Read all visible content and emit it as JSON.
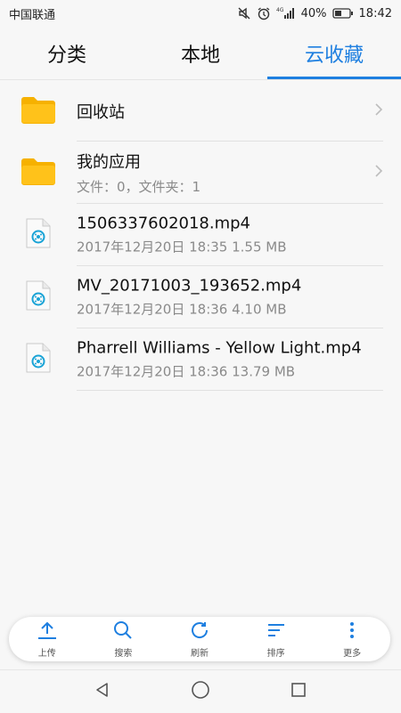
{
  "status": {
    "carrier": "中国联通",
    "network": "4G",
    "battery": "40%",
    "time": "18:42",
    "icons": [
      "mute-icon",
      "alarm-icon",
      "signal-icon",
      "battery-icon"
    ]
  },
  "tabs": [
    {
      "label": "分类",
      "active": false
    },
    {
      "label": "本地",
      "active": false
    },
    {
      "label": "云收藏",
      "active": true
    }
  ],
  "accent_color": "#1e7fe0",
  "folders": [
    {
      "name": "回收站",
      "detail": ""
    },
    {
      "name": "我的应用",
      "detail": "文件：0，文件夹：1"
    }
  ],
  "files": [
    {
      "name": "1506337602018.mp4",
      "detail": "2017年12月20日 18:35 1.55 MB"
    },
    {
      "name": "MV_20171003_193652.mp4",
      "detail": "2017年12月20日 18:36 4.10 MB"
    },
    {
      "name": "Pharrell Williams - Yellow Light.mp4",
      "detail": "2017年12月20日 18:36 13.79 MB"
    }
  ],
  "toolbar": {
    "upload": "上传",
    "search": "搜索",
    "refresh": "刷新",
    "sort": "排序",
    "more": "更多"
  },
  "navbar": [
    "back-icon",
    "home-icon",
    "recents-icon"
  ]
}
